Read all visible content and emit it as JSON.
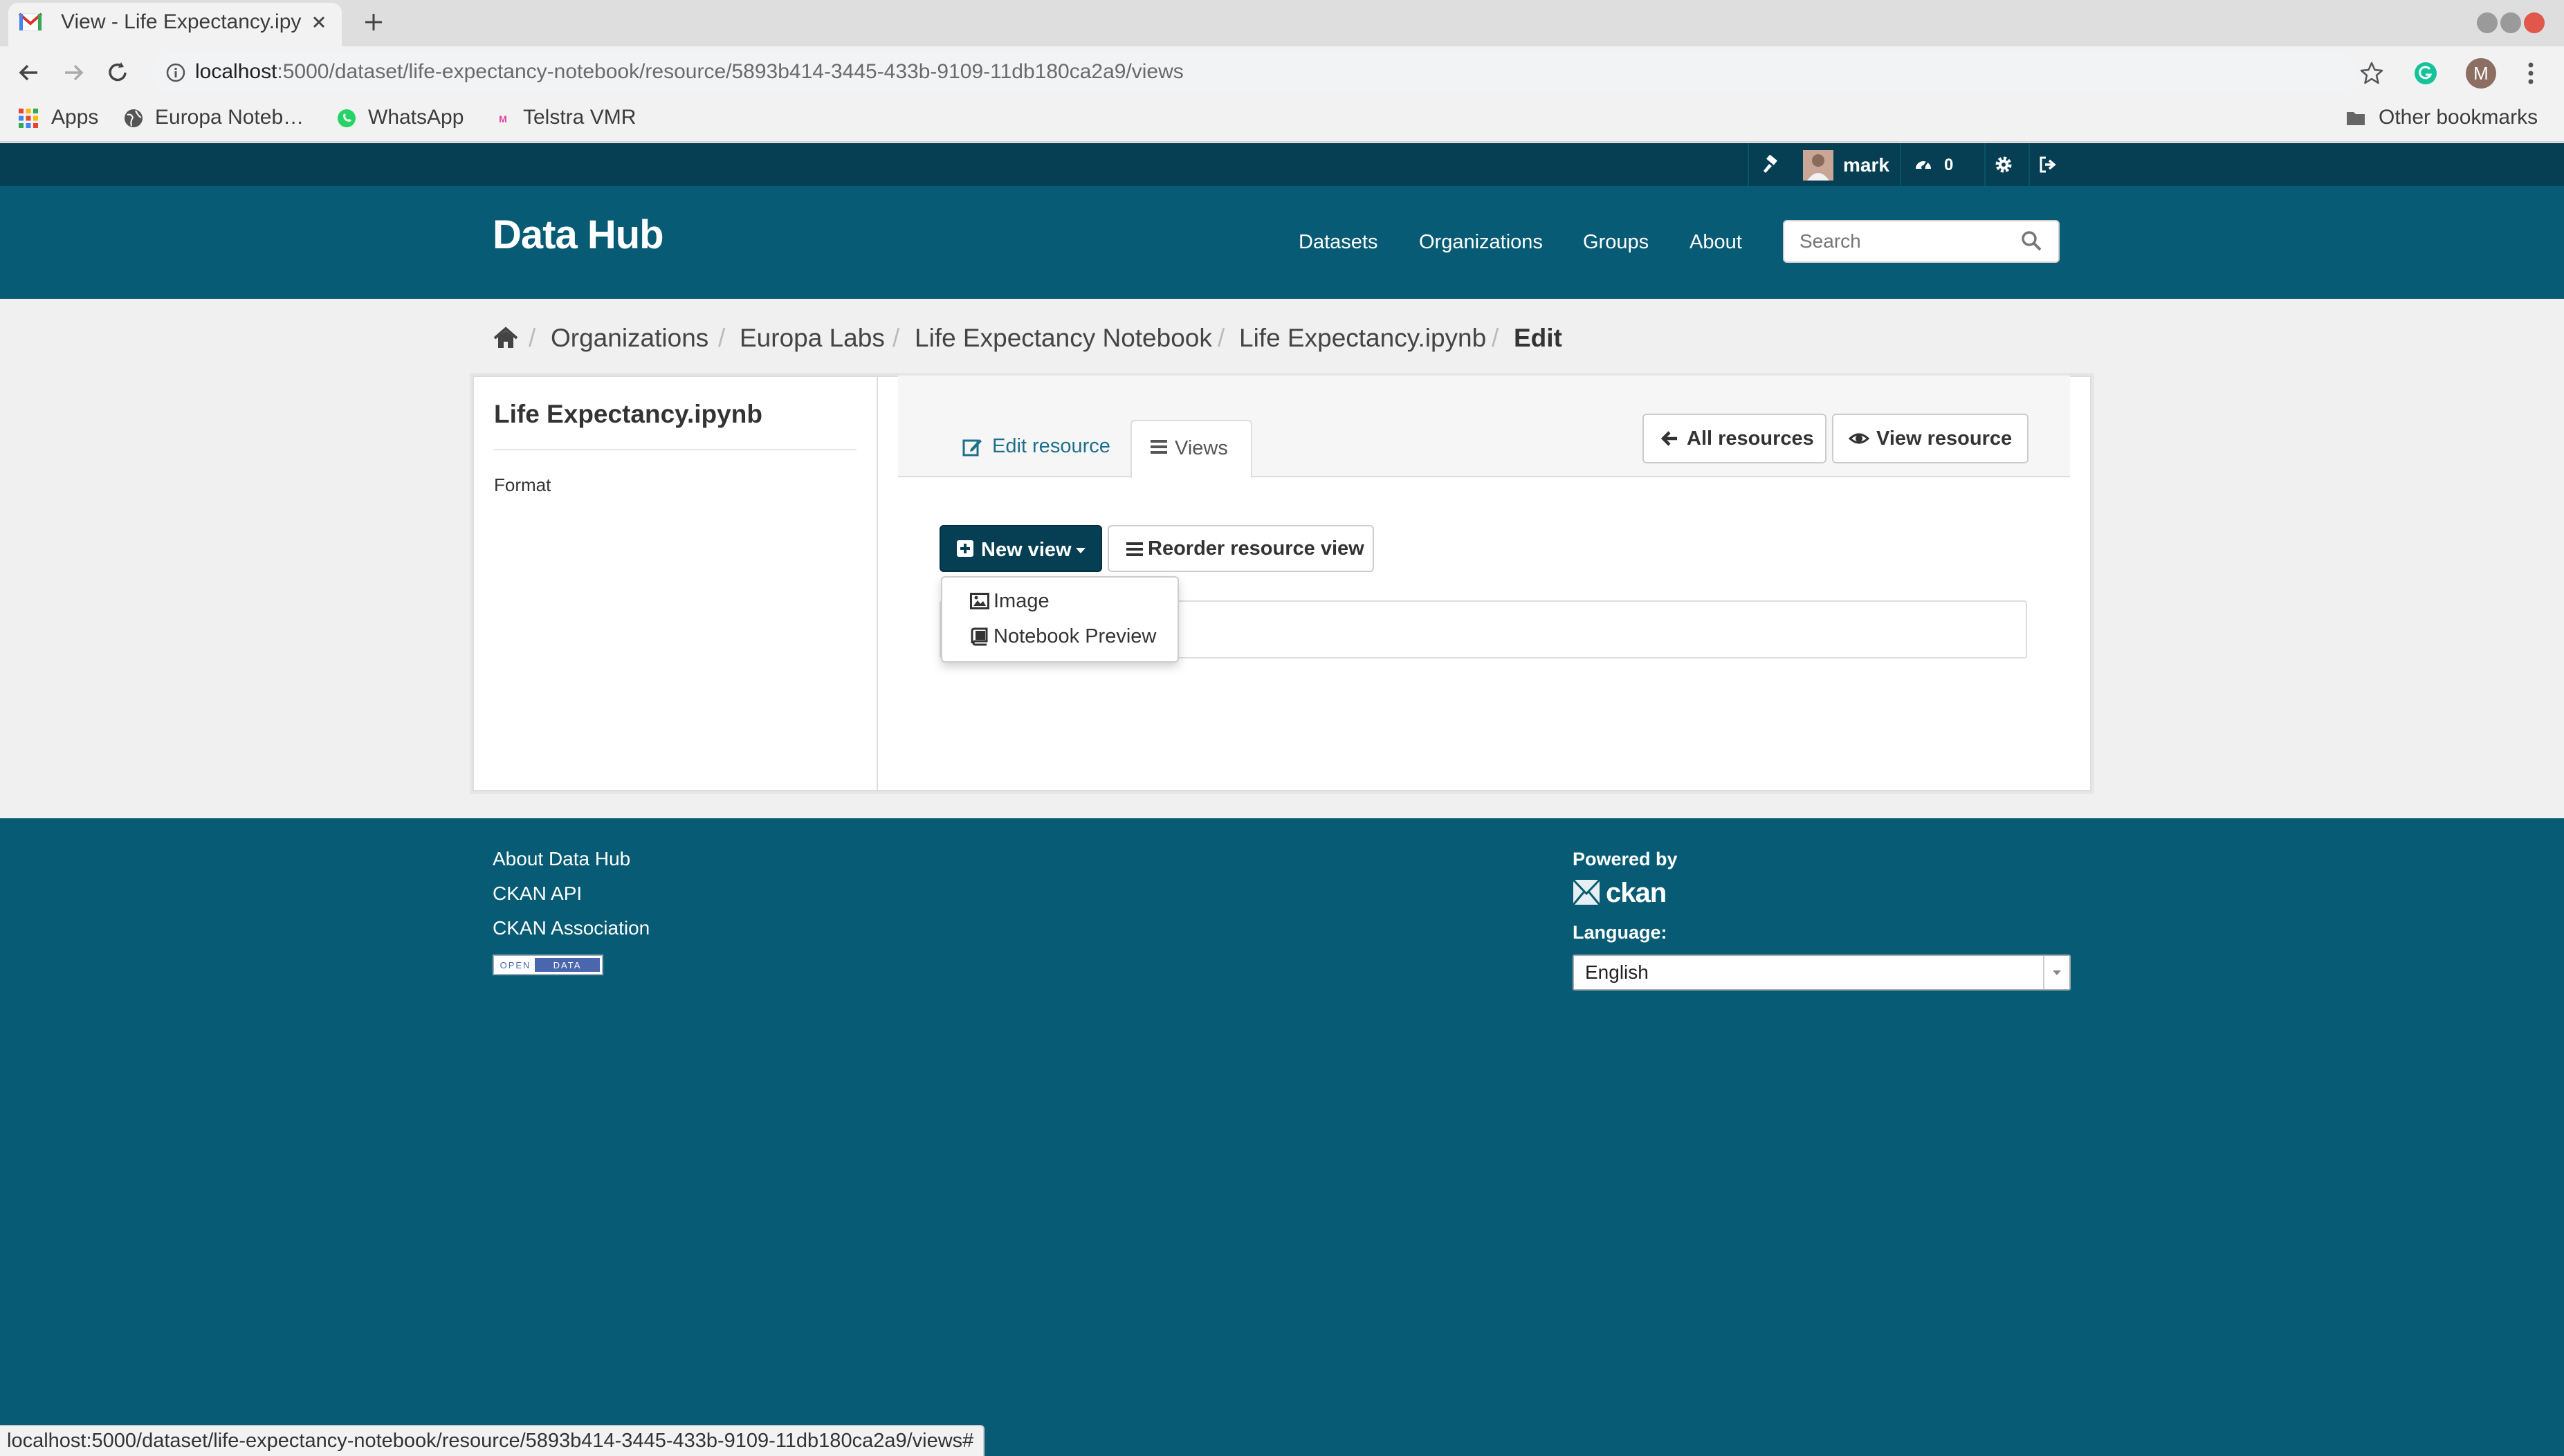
{
  "browser": {
    "tab_title": "View - Life Expectancy.ipy",
    "url_host": "localhost",
    "url_path": ":5000/dataset/life-expectancy-notebook/resource/5893b414-3445-433b-9109-11db180ca2a9/views",
    "profile_initial": "M",
    "bookmarks": [
      "Apps",
      "Europa Noteb…",
      "WhatsApp",
      "Telstra VMR"
    ],
    "other_bookmarks": "Other bookmarks",
    "status_url": "localhost:5000/dataset/life-expectancy-notebook/resource/5893b414-3445-433b-9109-11db180ca2a9/views#"
  },
  "account": {
    "username": "mark",
    "activity_count": "0"
  },
  "masthead": {
    "site_title": "Data Hub",
    "nav": [
      "Datasets",
      "Organizations",
      "Groups",
      "About"
    ],
    "search_placeholder": "Search"
  },
  "breadcrumb": {
    "items": [
      "Organizations",
      "Europa Labs",
      "Life Expectancy Notebook",
      "Life Expectancy.ipynb"
    ],
    "active": "Edit"
  },
  "resource": {
    "title": "Life Expectancy.ipynb",
    "format_label": "Format"
  },
  "tabs": {
    "edit": "Edit resource",
    "views": "Views"
  },
  "header_buttons": {
    "all_resources": "All resources",
    "view_resource": "View resource"
  },
  "actions": {
    "new_view": "New view",
    "reorder": "Reorder resource view"
  },
  "dropdown": {
    "items": [
      "Image",
      "Notebook Preview"
    ]
  },
  "footer": {
    "links": [
      "About Data Hub",
      "CKAN API",
      "CKAN Association"
    ],
    "open_data_badge": "OPEN DATA",
    "powered_by": "Powered by",
    "ckan_logo_text": "ckan",
    "language_label": "Language:",
    "language_value": "English"
  },
  "colors": {
    "account_bar": "#063f53",
    "masthead": "#075b74",
    "link": "#1f6f8b",
    "primary_button": "#063f53"
  }
}
